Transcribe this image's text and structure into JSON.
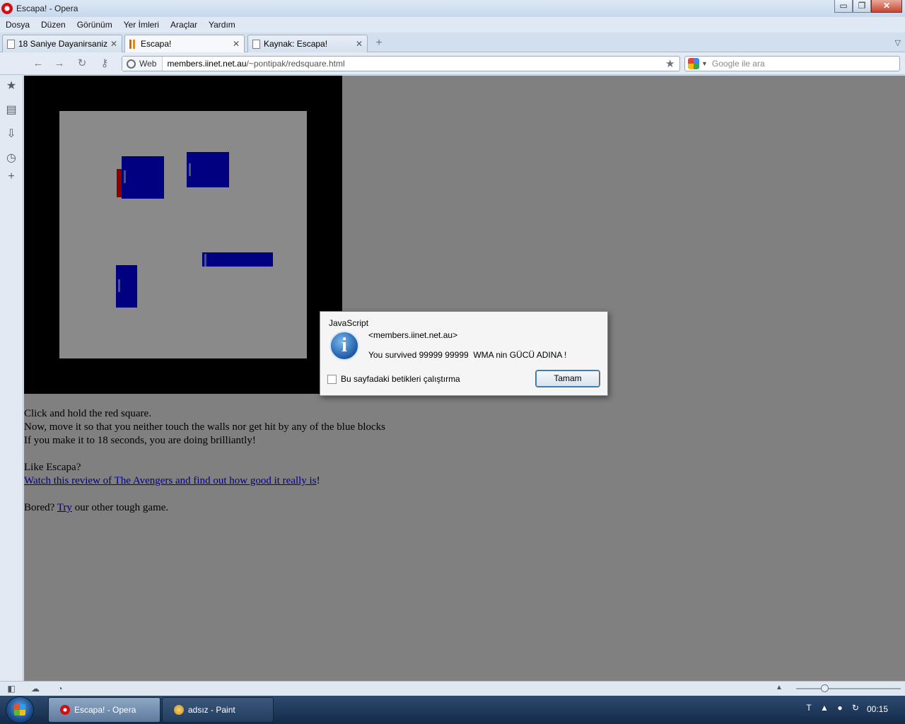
{
  "window": {
    "title": "Escapa! - Opera"
  },
  "window_controls": {
    "minimize": "▭",
    "maximize": "❐",
    "close": "✕"
  },
  "menu": [
    "Dosya",
    "Düzen",
    "Görünüm",
    "Yer İmleri",
    "Araçlar",
    "Yardım"
  ],
  "tabs": [
    {
      "label": "18 Saniye Dayanirsaniz ..."
    },
    {
      "label": "Escapa!"
    },
    {
      "label": "Kaynak: Escapa!"
    }
  ],
  "address": {
    "badge": "Web",
    "url_domain": "members.iinet.net.au",
    "url_path": "/~pontipak/redsquare.html"
  },
  "search": {
    "placeholder": "Google ile ara"
  },
  "page": {
    "instructions": [
      "Click and hold the red square.",
      "Now, move it so that you neither touch the walls nor get hit by any of the blue blocks",
      "If you make it to 18 seconds, you are doing brilliantly!"
    ],
    "like_heading": "Like Escapa?",
    "review_link": "Watch this review of The Avengers and find out how good it really is",
    "review_suffix": "!",
    "bored_prefix": "Bored? ",
    "try_link": "Try",
    "bored_suffix": " our other tough game."
  },
  "dialog": {
    "title": "JavaScript",
    "domain": "<members.iinet.net.au>",
    "message": "You survived 99999 99999  WMA nin GÜCÜ ADINA !",
    "checkbox_label": "Bu sayfadaki betikleri çalıştırma",
    "ok_label": "Tamam"
  },
  "taskbar": {
    "tasks": [
      {
        "label": "Escapa! - Opera"
      },
      {
        "label": "adsız - Paint"
      }
    ],
    "tray_letter": "T",
    "clock": "00:15"
  },
  "colors": {
    "wall": "#000000",
    "field": "#8a8a8a",
    "block": "#000080",
    "red_square": "#8b0000",
    "page_bg": "#808080",
    "link": "#00008b"
  }
}
